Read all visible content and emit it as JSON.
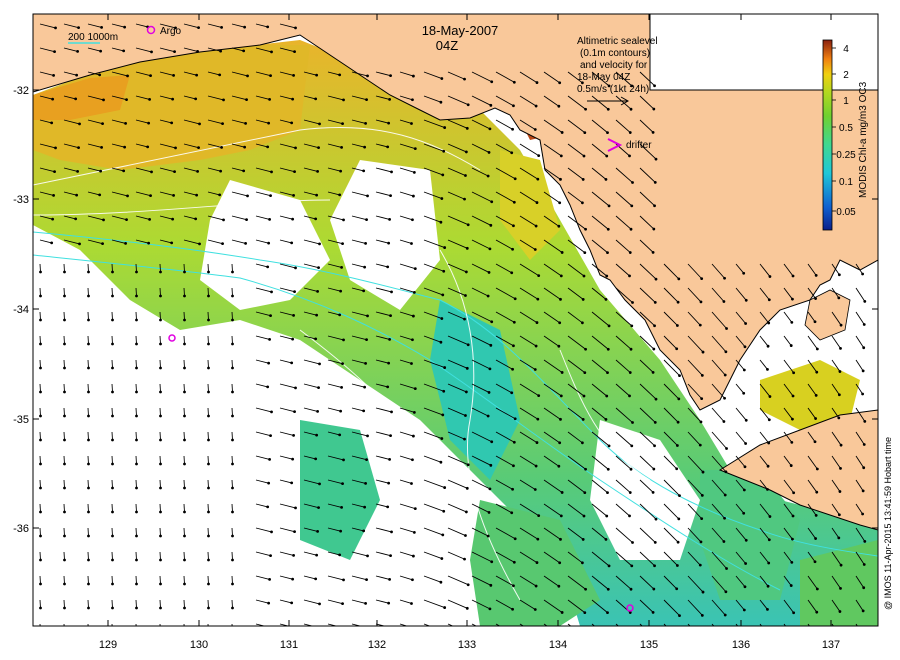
{
  "map": {
    "date_line": "18-May-2007",
    "time_line": "04Z",
    "depth_legend_label": "200  1000m",
    "argo_label": "Argo",
    "drifter_label": "drifter",
    "velocity_note": {
      "line1": "Altimetric sealevel",
      "line2": "(0.1m contours)",
      "line3": "and velocity for",
      "line4": "18-May 04Z",
      "line5": "0.5m/s (1kt 24h)"
    },
    "colorbar": {
      "title": "MODIS Chl-a mg/m3 OC3",
      "ticks": [
        "4",
        "2",
        "1",
        "0.5",
        "0.25",
        "0.1",
        "0.05"
      ]
    },
    "credit": "@ IMOS 11-Apr-2015 13:41:59 Hobart time",
    "lat_ticks": [
      "-32",
      "-33",
      "-34",
      "-35",
      "-36"
    ],
    "lon_ticks": [
      "129",
      "130",
      "131",
      "132",
      "133",
      "134",
      "135",
      "136",
      "137"
    ],
    "colors": {
      "land": "#f9c89a",
      "coast": "#000000",
      "contour_shelf": "#40e0e0",
      "contour_ssh": "#ffffff",
      "marker": "#e000e0"
    }
  }
}
